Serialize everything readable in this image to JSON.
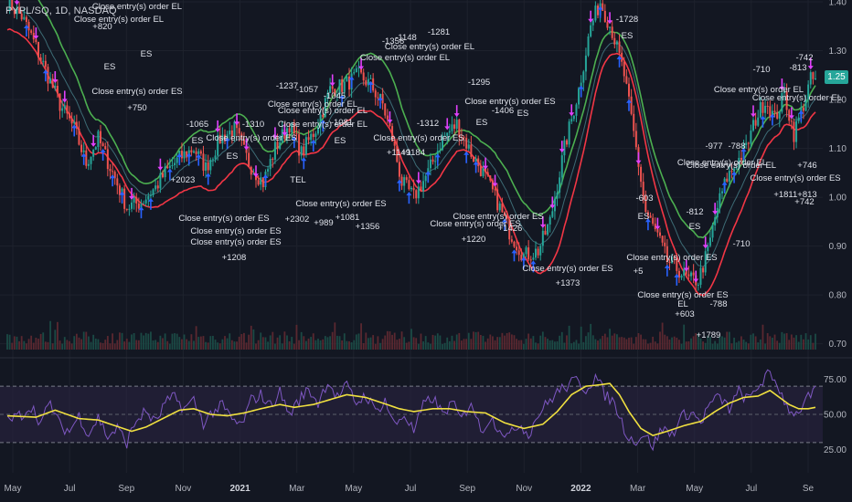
{
  "symbol_header": "PYPL/SQ, 1D, NASDAQ",
  "last_price_label": "1.25",
  "colors": {
    "background": "#131722",
    "up_candle": "#26a69a",
    "down_candle": "#ef5350",
    "fast_band": "#4caf50",
    "stop_line": "#f23645",
    "rsi_line": "#7e57c2",
    "rsi_ma": "#f0e040",
    "rsi_band": "#2b2443",
    "entry_long_marker": "#2962ff",
    "entry_short_marker": "#e040fb"
  },
  "chart_data": [
    {
      "type": "candlestick",
      "title": "",
      "x_tick_labels": [
        "May",
        "Jul",
        "Sep",
        "Nov",
        "2021",
        "Mar",
        "May",
        "Jul",
        "Sep",
        "Nov",
        "2022",
        "Mar",
        "May",
        "Jul",
        "Se"
      ],
      "y_tick_labels": [
        "1.40",
        "1.30",
        "1.20",
        "1.10",
        "1.00",
        "0.90",
        "0.80",
        "0.70"
      ],
      "ylim": [
        0.69,
        1.4
      ],
      "close_anchors": [
        [
          0,
          1.4
        ],
        [
          6,
          1.37
        ],
        [
          10,
          1.33
        ],
        [
          16,
          1.26
        ],
        [
          22,
          1.19
        ],
        [
          28,
          1.14
        ],
        [
          33,
          1.07
        ],
        [
          38,
          1.12
        ],
        [
          44,
          1.05
        ],
        [
          50,
          0.98
        ],
        [
          56,
          0.99
        ],
        [
          62,
          1.02
        ],
        [
          66,
          1.05
        ],
        [
          72,
          1.08
        ],
        [
          78,
          1.1
        ],
        [
          83,
          1.06
        ],
        [
          89,
          1.12
        ],
        [
          95,
          1.14
        ],
        [
          101,
          1.07
        ],
        [
          107,
          1.03
        ],
        [
          112,
          1.1
        ],
        [
          118,
          1.15
        ],
        [
          123,
          1.09
        ],
        [
          129,
          1.14
        ],
        [
          135,
          1.22
        ],
        [
          141,
          1.23
        ],
        [
          147,
          1.25
        ],
        [
          152,
          1.23
        ],
        [
          157,
          1.19
        ],
        [
          161,
          1.12
        ],
        [
          165,
          1.03
        ],
        [
          170,
          1.0
        ],
        [
          176,
          1.05
        ],
        [
          182,
          1.12
        ],
        [
          188,
          1.15
        ],
        [
          194,
          1.09
        ],
        [
          199,
          1.05
        ],
        [
          205,
          0.99
        ],
        [
          210,
          0.93
        ],
        [
          216,
          0.88
        ],
        [
          222,
          0.89
        ],
        [
          227,
          0.95
        ],
        [
          233,
          1.1
        ],
        [
          239,
          1.22
        ],
        [
          244,
          1.35
        ],
        [
          248,
          1.4
        ],
        [
          253,
          1.34
        ],
        [
          258,
          1.25
        ],
        [
          263,
          1.1
        ],
        [
          267,
          0.97
        ],
        [
          272,
          0.92
        ],
        [
          276,
          0.87
        ],
        [
          281,
          0.85
        ],
        [
          285,
          0.83
        ],
        [
          289,
          0.83
        ],
        [
          293,
          0.89
        ],
        [
          297,
          0.98
        ],
        [
          301,
          1.04
        ],
        [
          305,
          1.07
        ],
        [
          309,
          1.1
        ],
        [
          313,
          1.16
        ],
        [
          317,
          1.2
        ],
        [
          321,
          1.16
        ],
        [
          325,
          1.21
        ],
        [
          329,
          1.13
        ],
        [
          333,
          1.19
        ],
        [
          336,
          1.24
        ]
      ],
      "volume_scale": [
        0,
        1
      ]
    },
    {
      "type": "line",
      "title": "",
      "ylim": [
        15,
        85
      ],
      "y_tick_labels": [
        "75.00",
        "50.00",
        "25.00"
      ],
      "band_levels": [
        70,
        30
      ],
      "mid_level": 50,
      "rsi_ma_anchors": [
        [
          0,
          49
        ],
        [
          12,
          48
        ],
        [
          20,
          53
        ],
        [
          30,
          47
        ],
        [
          38,
          46
        ],
        [
          45,
          42
        ],
        [
          52,
          38
        ],
        [
          58,
          41
        ],
        [
          65,
          47
        ],
        [
          72,
          53
        ],
        [
          78,
          54
        ],
        [
          85,
          50
        ],
        [
          92,
          49
        ],
        [
          99,
          51
        ],
        [
          106,
          54
        ],
        [
          114,
          57
        ],
        [
          120,
          55
        ],
        [
          128,
          57
        ],
        [
          134,
          60
        ],
        [
          142,
          64
        ],
        [
          150,
          62
        ],
        [
          157,
          58
        ],
        [
          164,
          54
        ],
        [
          170,
          52
        ],
        [
          178,
          54
        ],
        [
          185,
          54
        ],
        [
          192,
          52
        ],
        [
          200,
          51
        ],
        [
          208,
          44
        ],
        [
          216,
          40
        ],
        [
          224,
          43
        ],
        [
          230,
          52
        ],
        [
          236,
          64
        ],
        [
          242,
          70
        ],
        [
          248,
          71
        ],
        [
          252,
          72
        ],
        [
          256,
          64
        ],
        [
          260,
          52
        ],
        [
          265,
          40
        ],
        [
          270,
          35
        ],
        [
          276,
          38
        ],
        [
          283,
          42
        ],
        [
          290,
          45
        ],
        [
          296,
          52
        ],
        [
          302,
          58
        ],
        [
          308,
          62
        ],
        [
          314,
          63
        ],
        [
          319,
          67
        ],
        [
          323,
          62
        ],
        [
          327,
          57
        ],
        [
          331,
          54
        ],
        [
          335,
          54
        ],
        [
          338,
          55
        ]
      ],
      "rsi_raw_anchors": [
        [
          0,
          45
        ],
        [
          6,
          50
        ],
        [
          10,
          56
        ],
        [
          14,
          44
        ],
        [
          18,
          58
        ],
        [
          22,
          42
        ],
        [
          26,
          38
        ],
        [
          30,
          49
        ],
        [
          34,
          36
        ],
        [
          38,
          48
        ],
        [
          42,
          34
        ],
        [
          46,
          40
        ],
        [
          50,
          30
        ],
        [
          54,
          46
        ],
        [
          58,
          52
        ],
        [
          62,
          44
        ],
        [
          66,
          58
        ],
        [
          70,
          62
        ],
        [
          74,
          54
        ],
        [
          78,
          60
        ],
        [
          82,
          44
        ],
        [
          86,
          52
        ],
        [
          90,
          56
        ],
        [
          94,
          46
        ],
        [
          98,
          42
        ],
        [
          102,
          60
        ],
        [
          106,
          64
        ],
        [
          110,
          56
        ],
        [
          114,
          66
        ],
        [
          118,
          50
        ],
        [
          122,
          60
        ],
        [
          126,
          68
        ],
        [
          130,
          58
        ],
        [
          134,
          74
        ],
        [
          138,
          62
        ],
        [
          142,
          70
        ],
        [
          146,
          58
        ],
        [
          150,
          64
        ],
        [
          154,
          52
        ],
        [
          158,
          60
        ],
        [
          162,
          42
        ],
        [
          166,
          50
        ],
        [
          170,
          38
        ],
        [
          174,
          56
        ],
        [
          178,
          62
        ],
        [
          182,
          50
        ],
        [
          186,
          58
        ],
        [
          190,
          46
        ],
        [
          194,
          60
        ],
        [
          198,
          38
        ],
        [
          202,
          48
        ],
        [
          206,
          40
        ],
        [
          210,
          34
        ],
        [
          214,
          44
        ],
        [
          218,
          36
        ],
        [
          222,
          50
        ],
        [
          226,
          58
        ],
        [
          230,
          66
        ],
        [
          234,
          70
        ],
        [
          238,
          74
        ],
        [
          242,
          68
        ],
        [
          246,
          77
        ],
        [
          250,
          64
        ],
        [
          254,
          58
        ],
        [
          258,
          40
        ],
        [
          262,
          30
        ],
        [
          266,
          36
        ],
        [
          270,
          28
        ],
        [
          274,
          40
        ],
        [
          278,
          36
        ],
        [
          282,
          48
        ],
        [
          286,
          52
        ],
        [
          290,
          44
        ],
        [
          294,
          58
        ],
        [
          298,
          62
        ],
        [
          302,
          54
        ],
        [
          306,
          66
        ],
        [
          310,
          60
        ],
        [
          314,
          70
        ],
        [
          318,
          78
        ],
        [
          322,
          72
        ],
        [
          326,
          56
        ],
        [
          330,
          50
        ],
        [
          334,
          60
        ],
        [
          338,
          66
        ]
      ]
    }
  ],
  "annotations": [
    {
      "text": "Close entry(s) order EL",
      "x": 150,
      "y": 10
    },
    {
      "text": "Close entry(s) order EL",
      "x": 130,
      "y": 24
    },
    {
      "text": "+820",
      "x": 112,
      "y": 32
    },
    {
      "text": "ES",
      "x": 160,
      "y": 62
    },
    {
      "text": "ES",
      "x": 120,
      "y": 76
    },
    {
      "text": "Close entry(s) order ES",
      "x": 150,
      "y": 103
    },
    {
      "text": "+750",
      "x": 150,
      "y": 121
    },
    {
      "text": "-1065",
      "x": 216,
      "y": 139
    },
    {
      "text": "ES",
      "x": 216,
      "y": 157
    },
    {
      "text": "Close entry(s) order ES",
      "x": 275,
      "y": 154
    },
    {
      "text": "ES",
      "x": 254,
      "y": 174
    },
    {
      "text": "+2023",
      "x": 200,
      "y": 200
    },
    {
      "text": "-1310",
      "x": 277,
      "y": 139
    },
    {
      "text": "-1237",
      "x": 314,
      "y": 97
    },
    {
      "text": "-1057",
      "x": 336,
      "y": 101
    },
    {
      "text": "Close entry(s) order EL",
      "x": 342,
      "y": 117
    },
    {
      "text": "Close entry(s) order EL",
      "x": 353,
      "y": 124
    },
    {
      "text": "Close entry(s) order EL",
      "x": 353,
      "y": 139
    },
    {
      "text": "-1045",
      "x": 366,
      "y": 108
    },
    {
      "text": "-1081",
      "x": 374,
      "y": 137
    },
    {
      "text": "ES",
      "x": 372,
      "y": 157
    },
    {
      "text": "TEL",
      "x": 326,
      "y": 200
    },
    {
      "text": "Close entry(s) order ES",
      "x": 245,
      "y": 242
    },
    {
      "text": "Close entry(s) order ES",
      "x": 258,
      "y": 256
    },
    {
      "text": "Close entry(s) order ES",
      "x": 258,
      "y": 268
    },
    {
      "text": "+1208",
      "x": 256,
      "y": 285
    },
    {
      "text": "+2302",
      "x": 325,
      "y": 243
    },
    {
      "text": "+989",
      "x": 354,
      "y": 247
    },
    {
      "text": "Close entry(s) order ES",
      "x": 373,
      "y": 226
    },
    {
      "text": "+1081",
      "x": 380,
      "y": 241
    },
    {
      "text": "+1356",
      "x": 402,
      "y": 251
    },
    {
      "text": "-1356",
      "x": 430,
      "y": 48
    },
    {
      "text": "-1148",
      "x": 444,
      "y": 44
    },
    {
      "text": "-1281",
      "x": 480,
      "y": 38
    },
    {
      "text": "Close entry(s) order EL",
      "x": 443,
      "y": 66
    },
    {
      "text": "Close entry(s) order EL",
      "x": 470,
      "y": 54
    },
    {
      "text": "Close entry(s) order ES",
      "x": 458,
      "y": 154
    },
    {
      "text": "+1149",
      "x": 436,
      "y": 170
    },
    {
      "text": "+1184",
      "x": 452,
      "y": 170
    },
    {
      "text": "-1312",
      "x": 468,
      "y": 138
    },
    {
      "text": "-1295",
      "x": 524,
      "y": 93
    },
    {
      "text": "-1406",
      "x": 550,
      "y": 124
    },
    {
      "text": "Close entry(s) order ES",
      "x": 558,
      "y": 114
    },
    {
      "text": "ES",
      "x": 572,
      "y": 127
    },
    {
      "text": "ES",
      "x": 527,
      "y": 137
    },
    {
      "text": "Close entry(s) order ES",
      "x": 520,
      "y": 248
    },
    {
      "text": "+1220",
      "x": 518,
      "y": 265
    },
    {
      "text": "Close entry(s) order ES",
      "x": 545,
      "y": 240
    },
    {
      "text": "+1426",
      "x": 558,
      "y": 253
    },
    {
      "text": "Close entry(s) order ES",
      "x": 621,
      "y": 297
    },
    {
      "text": "+1373",
      "x": 621,
      "y": 313
    },
    {
      "text": "-1728",
      "x": 686,
      "y": 24
    },
    {
      "text": "ES",
      "x": 686,
      "y": 42
    },
    {
      "text": "-603",
      "x": 705,
      "y": 220
    },
    {
      "text": "ES",
      "x": 704,
      "y": 240
    },
    {
      "text": "-812",
      "x": 760,
      "y": 235
    },
    {
      "text": "ES",
      "x": 760,
      "y": 251
    },
    {
      "text": "Close entry(s) order ES",
      "x": 735,
      "y": 285
    },
    {
      "text": "+5",
      "x": 698,
      "y": 300
    },
    {
      "text": "Close entry(s) order ES",
      "x": 747,
      "y": 326
    },
    {
      "text": "+603",
      "x": 749,
      "y": 347
    },
    {
      "text": "-788",
      "x": 786,
      "y": 336
    },
    {
      "text": "+1789",
      "x": 775,
      "y": 370
    },
    {
      "text": "EL",
      "x": 747,
      "y": 336
    },
    {
      "text": "-977",
      "x": 781,
      "y": 163
    },
    {
      "text": "-788",
      "x": 806,
      "y": 163
    },
    {
      "text": "Close entry(s) order EL",
      "x": 790,
      "y": 181
    },
    {
      "text": "Close entry(s) order EL",
      "x": 800,
      "y": 184
    },
    {
      "text": "-710",
      "x": 811,
      "y": 270
    },
    {
      "text": "-742",
      "x": 880,
      "y": 66
    },
    {
      "text": "-710",
      "x": 833,
      "y": 79
    },
    {
      "text": "-813",
      "x": 873,
      "y": 77
    },
    {
      "text": "Close entry(s) order EL",
      "x": 830,
      "y": 101
    },
    {
      "text": "Close entry(s) order EL",
      "x": 872,
      "y": 110
    },
    {
      "text": "+746",
      "x": 883,
      "y": 184
    },
    {
      "text": "Close entry(s) order ES",
      "x": 870,
      "y": 198
    },
    {
      "text": "+1811+813",
      "x": 870,
      "y": 216
    },
    {
      "text": "+742",
      "x": 880,
      "y": 224
    }
  ]
}
